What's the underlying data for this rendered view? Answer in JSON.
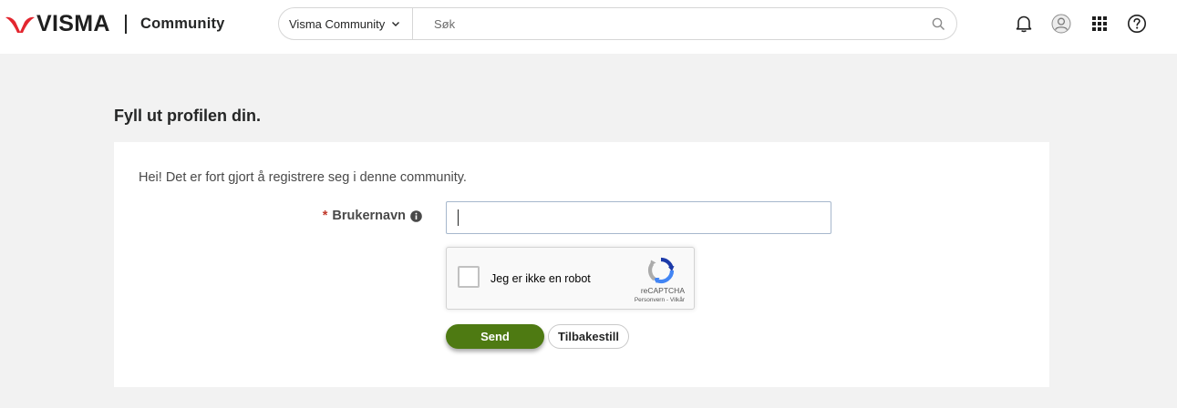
{
  "header": {
    "logo_text": "VISMA",
    "community_title": "Community",
    "search": {
      "scope_label": "Visma Community",
      "placeholder": "Søk"
    },
    "icons": [
      "bell-icon",
      "user-avatar-icon",
      "apps-grid-icon",
      "help-icon"
    ]
  },
  "page": {
    "title": "Fyll ut profilen din."
  },
  "form": {
    "intro": "Hei! Det er fort gjort å registrere seg i denne community.",
    "username_required_mark": "*",
    "username_label": "Brukernavn",
    "username_value": "",
    "captcha": {
      "label": "Jeg er ikke en robot",
      "brand": "reCAPTCHA",
      "links": "Personvern - Vilkår"
    },
    "send_label": "Send",
    "reset_label": "Tilbakestill"
  },
  "colors": {
    "brand_red": "#e3262f",
    "primary_green": "#4e7a12",
    "page_bg": "#f2f2f2",
    "text": "#252626"
  }
}
